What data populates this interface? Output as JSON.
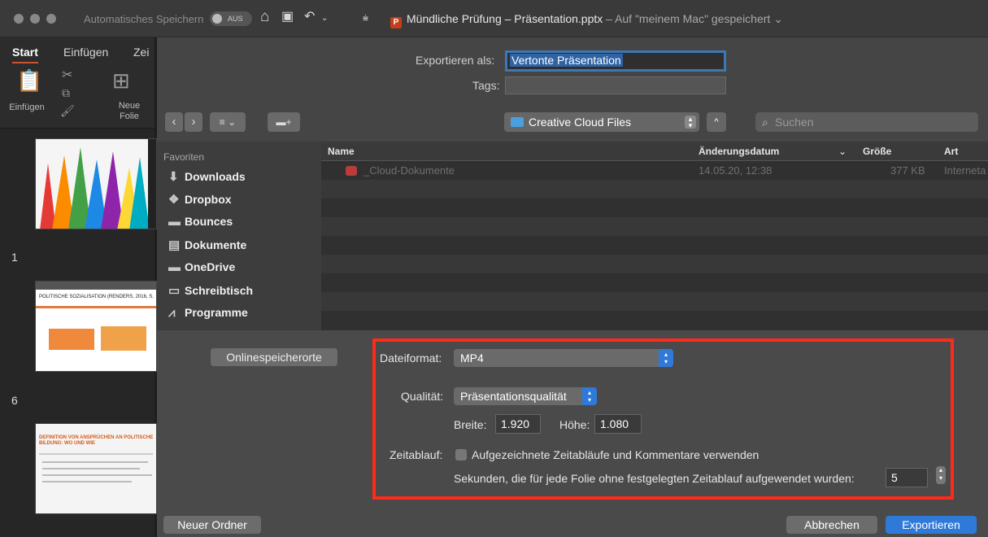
{
  "titlebar": {
    "autosave_label": "Automatisches Speichern",
    "autosave_state": "AUS",
    "doc_name": "Mündliche Prüfung – Präsentation.pptx",
    "doc_sub": "– Auf \"meinem Mac\" gespeichert"
  },
  "ribbon": {
    "tabs": [
      "Start",
      "Einfügen",
      "Zei"
    ],
    "paste_label": "Einfügen",
    "new_slide_label": "Neue Folie"
  },
  "thumbnails": {
    "numbers": [
      "1",
      "6"
    ],
    "slide2_title": "POLITISCHE SOZIALISATION (RENDERS, 2016, S.",
    "slide3_title": "DEFINITION VON ANSPRÜCHEN AN POLITISCHE BILDUNG: WO UND WIE"
  },
  "dialog": {
    "export_as_label": "Exportieren als:",
    "export_as_value": "Vertonte Präsentation",
    "tags_label": "Tags:",
    "tags_value": "",
    "location": "Creative Cloud Files",
    "search_placeholder": "Suchen",
    "sidebar": {
      "heading": "Favoriten",
      "items": [
        {
          "icon": "downloads-icon",
          "label": "Downloads"
        },
        {
          "icon": "dropbox-icon",
          "label": "Dropbox"
        },
        {
          "icon": "folder-icon",
          "label": "Bounces"
        },
        {
          "icon": "documents-icon",
          "label": "Dokumente"
        },
        {
          "icon": "folder-icon",
          "label": "OneDrive"
        },
        {
          "icon": "desktop-icon",
          "label": "Schreibtisch"
        },
        {
          "icon": "applications-icon",
          "label": "Programme"
        }
      ]
    },
    "columns": {
      "name": "Name",
      "date": "Änderungsdatum",
      "size": "Größe",
      "kind": "Art"
    },
    "files": [
      {
        "name": "_Cloud-Dokumente",
        "date": "14.05.20, 12:38",
        "size": "377 KB",
        "kind": "Interneta"
      }
    ],
    "online_locations": "Onlinespeicherorte",
    "options": {
      "format_label": "Dateiformat:",
      "format_value": "MP4",
      "quality_label": "Qualität:",
      "quality_value": "Präsentationsqualität",
      "width_label": "Breite:",
      "width_value": "1.920",
      "height_label": "Höhe:",
      "height_value": "1.080",
      "timing_label": "Zeitablauf:",
      "timing_checkbox": "Aufgezeichnete Zeitabläufe und Kommentare verwenden",
      "seconds_label": "Sekunden, die für jede Folie ohne festgelegten Zeitablauf aufgewendet wurden:",
      "seconds_value": "5"
    },
    "new_folder": "Neuer Ordner",
    "cancel": "Abbrechen",
    "export": "Exportieren"
  }
}
